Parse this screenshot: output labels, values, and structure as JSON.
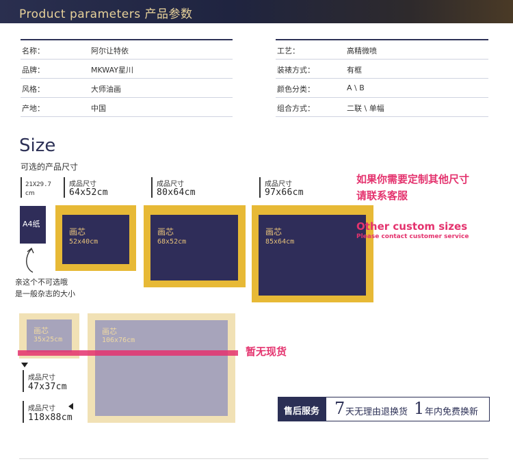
{
  "header": {
    "title": "Product parameters 产品参数"
  },
  "params_left": [
    {
      "key": "名称：",
      "value": "阿尔让特依"
    },
    {
      "key": "品牌：",
      "value": "MKWAY星川"
    },
    {
      "key": "风格：",
      "value": "大师油画"
    },
    {
      "key": "产地：",
      "value": "中国"
    }
  ],
  "params_right": [
    {
      "key": "工艺：",
      "value": "高精微喷"
    },
    {
      "key": "装裱方式：",
      "value": "有框"
    },
    {
      "key": "颜色分类：",
      "value": "A \\ B"
    },
    {
      "key": "组合方式：",
      "value": "二联 \\ 单幅"
    }
  ],
  "size": {
    "title": "Size",
    "subtitle": "可选的产品尺寸",
    "a4": {
      "dim": "21X29.7",
      "unit": "cm",
      "label": "A4纸",
      "note1": "亲这个不可选哦",
      "note2": "是一般杂志的大小"
    },
    "finished_label": "成品尺寸",
    "core_label": "画芯",
    "available": [
      {
        "finished": "64x52cm",
        "core": "52x40cm"
      },
      {
        "finished": "80x64cm",
        "core": "68x52cm"
      },
      {
        "finished": "97x66cm",
        "core": "85x64cm"
      }
    ],
    "unavailable": [
      {
        "finished": "47x37cm",
        "core": "35x25cm"
      },
      {
        "finished": "118x88cm",
        "core": "106x76cm"
      }
    ],
    "out_of_stock": "暂无现货",
    "custom_cn_1": "如果你需要定制其他尺寸",
    "custom_cn_2": "请联系客服",
    "custom_en_1": "Other custom sizes",
    "custom_en_2": "Please contact customer service"
  },
  "service": {
    "tag": "售后服务",
    "num1": "7",
    "text1": "天无理由退换货",
    "num2": "1",
    "text2": "年内免费换新"
  },
  "colors": {
    "navy": "#2b2f55",
    "gold": "#e7b936",
    "pink": "#e4336e"
  }
}
